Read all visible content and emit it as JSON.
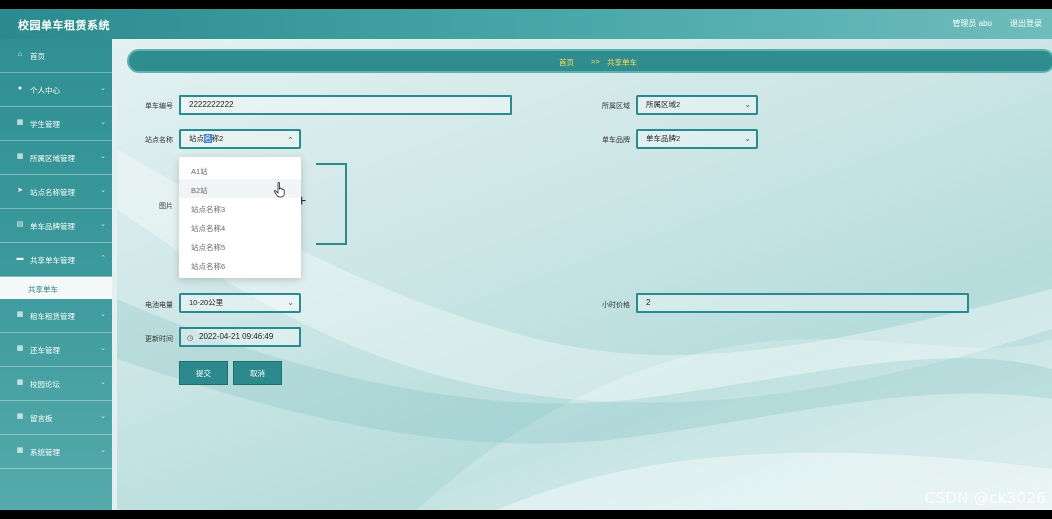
{
  "header": {
    "app_title": "校园单车租赁系统",
    "user_label": "管理员 abo",
    "logout_label": "退出登录"
  },
  "sidebar": {
    "items": [
      {
        "label": "首页",
        "icon": "home-icon"
      },
      {
        "label": "个人中心",
        "icon": "user-icon"
      },
      {
        "label": "学生管理",
        "icon": "grid-icon"
      },
      {
        "label": "所属区域管理",
        "icon": "grid-icon"
      },
      {
        "label": "站点名称管理",
        "icon": "send-icon"
      },
      {
        "label": "单车品牌管理",
        "icon": "clipboard-icon"
      },
      {
        "label": "共享单车管理",
        "icon": "card-icon"
      },
      {
        "label": "租车租赁管理",
        "icon": "grid-icon"
      },
      {
        "label": "还车管理",
        "icon": "grid-icon"
      },
      {
        "label": "校园论坛",
        "icon": "grid-icon"
      },
      {
        "label": "留言板",
        "icon": "grid-icon"
      },
      {
        "label": "系统管理",
        "icon": "grid-icon"
      }
    ],
    "active_sub": "共享单车"
  },
  "breadcrumb": {
    "home": "首页",
    "separator": ">>",
    "current": "共享单车"
  },
  "form": {
    "bike_no_label": "单车编号",
    "bike_no_value": "2222222222",
    "area_label": "所属区域",
    "area_value": "所属区域2",
    "station_label": "站点名称",
    "station_value_prefix": "站点",
    "station_value_selected": "名",
    "station_value_suffix": "称2",
    "brand_label": "单车品牌",
    "brand_value": "单车品牌2",
    "image_label": "图片",
    "battery_label": "电池电量",
    "battery_value": "10-20公里",
    "price_label": "小时价格",
    "price_value": "2",
    "update_label": "更新时间",
    "update_value": "2022-04-21 09:46:49",
    "submit_label": "提交",
    "cancel_label": "取消"
  },
  "station_dropdown": {
    "options": [
      "A1站",
      "B2站",
      "站点名称3",
      "站点名称4",
      "站点名称5",
      "站点名称6"
    ],
    "hovered_index": 1
  },
  "watermark": "CSDN @ck3026",
  "colors": {
    "primary": "#2a8a8d",
    "breadcrumb_text": "#ffe04a"
  }
}
